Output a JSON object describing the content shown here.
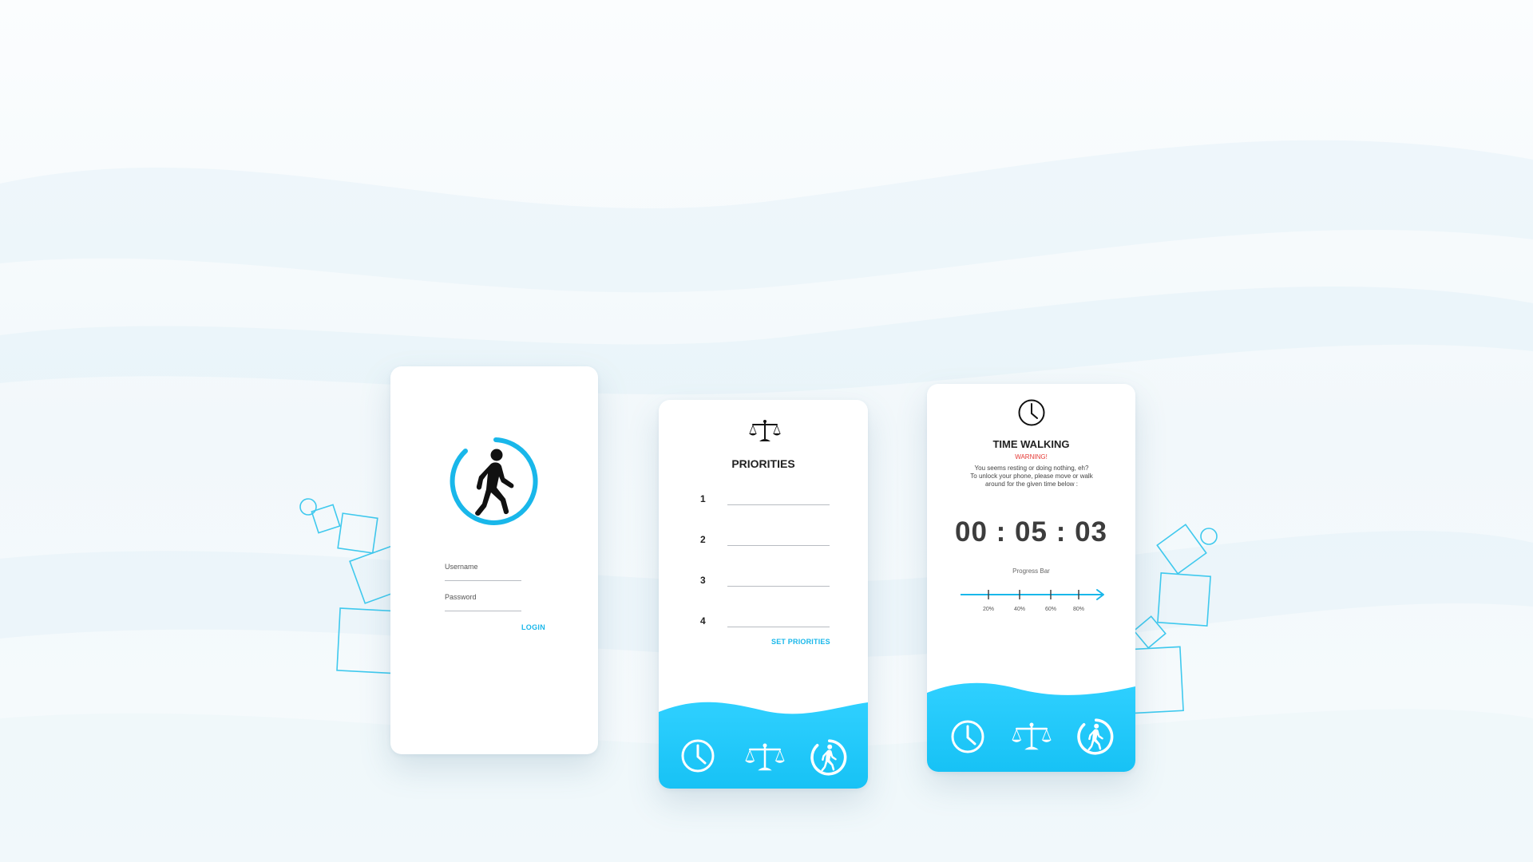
{
  "login": {
    "username_label": "Username",
    "password_label": "Password",
    "login_label": "LOGIN"
  },
  "priorities": {
    "title": "PRIORITIES",
    "rows": [
      "1",
      "2",
      "3",
      "4"
    ],
    "set_label": "SET PRIORITIES"
  },
  "timer": {
    "title": "TIME WALKING",
    "warning": "WARNING!",
    "message_lines": [
      "You seems resting or doing nothing, eh?",
      "To unlock your phone, please move or walk",
      "around for the given time below :"
    ],
    "time": "00 : 05 : 03",
    "progress_label": "Progress Bar",
    "progress_ticks": [
      "20%",
      "40%",
      "60%",
      "80%"
    ]
  },
  "nav_icons": [
    "clock-icon",
    "scale-icon",
    "walking-icon"
  ],
  "colors": {
    "accent": "#19b7ea",
    "accent_light": "#2fd0ff",
    "warning": "#e53935",
    "text": "#222222"
  }
}
